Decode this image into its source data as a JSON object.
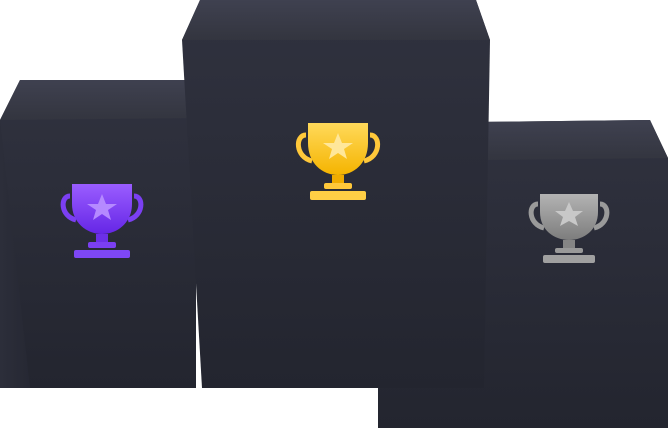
{
  "scene": {
    "podiums": [
      {
        "place": "second",
        "trophy_icon": "purple-trophy-icon",
        "trophy_color": "#7b3ff2"
      },
      {
        "place": "first",
        "trophy_icon": "gold-trophy-icon",
        "trophy_color": "#ffc83a"
      },
      {
        "place": "third",
        "trophy_icon": "silver-trophy-icon",
        "trophy_color": "#9a9a9a"
      }
    ],
    "colors": {
      "podium_top": "#3a3c4a",
      "podium_front": "#2a2c38",
      "background": "#ffffff"
    }
  }
}
